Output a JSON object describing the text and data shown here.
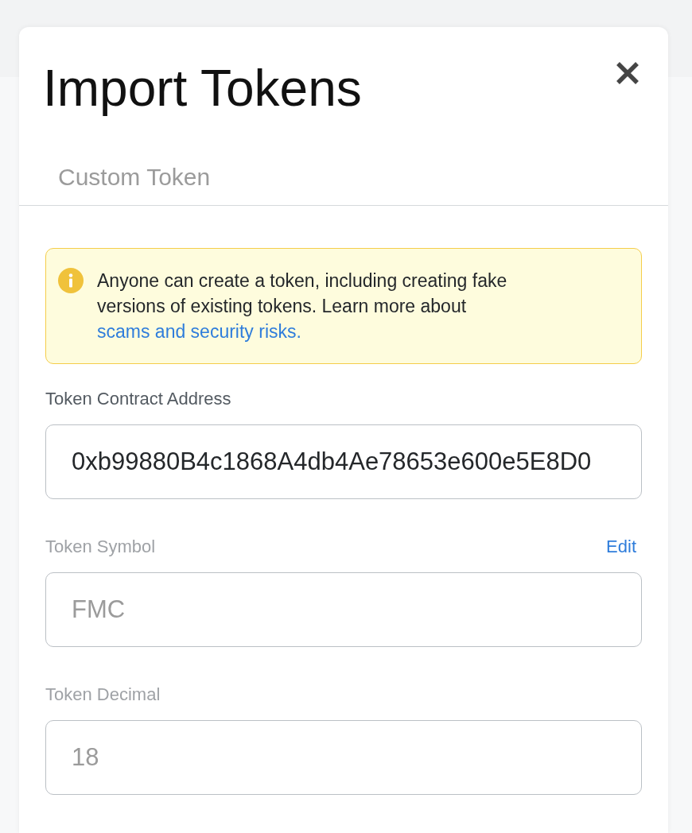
{
  "modal": {
    "title": "Import Tokens"
  },
  "tabs": [
    {
      "label": "Custom Token",
      "selected": false
    }
  ],
  "alert": {
    "text": "Anyone can create a token, including creating fake versions of existing tokens. Learn more about ",
    "link": "scams and security risks."
  },
  "fields": [
    {
      "label": "Token Contract Address",
      "value": "0xb99880B4c1868A4db4Ae78653e600e5E8D0",
      "disabled": false
    },
    {
      "label": "Token Symbol",
      "value": "FMC",
      "disabled": true,
      "action": "Edit"
    },
    {
      "label": "Token Decimal",
      "value": "18",
      "disabled": true
    }
  ]
}
